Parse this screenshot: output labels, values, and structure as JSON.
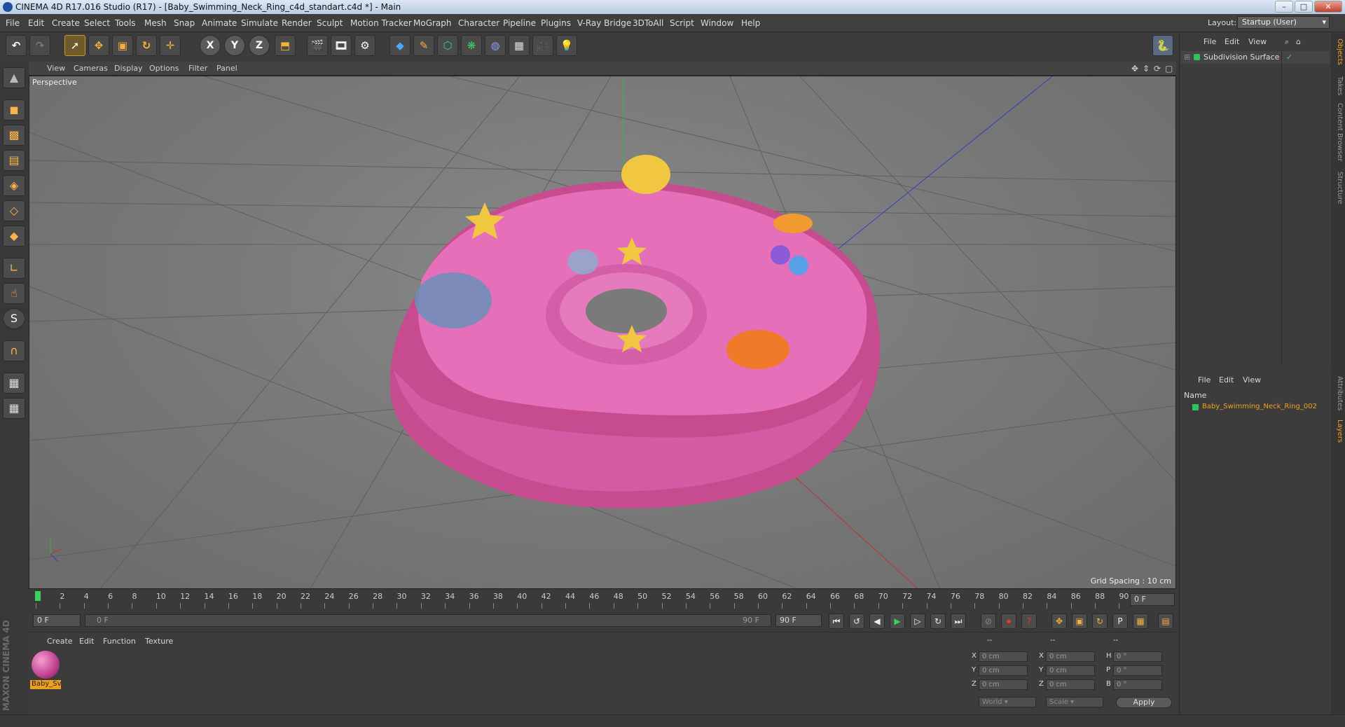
{
  "window": {
    "title": "CINEMA 4D R17.016 Studio (R17) - [Baby_Swimming_Neck_Ring_c4d_standart.c4d *] - Main"
  },
  "menu": [
    "File",
    "Edit",
    "Create",
    "Select",
    "Tools",
    "Mesh",
    "Snap",
    "Animate",
    "Simulate",
    "Render",
    "Sculpt",
    "Motion Tracker",
    "MoGraph",
    "Character",
    "Pipeline",
    "Plugins",
    "V-Ray Bridge",
    "3DToAll",
    "Script",
    "Window",
    "Help"
  ],
  "layout": {
    "label": "Layout:",
    "value": "Startup (User)"
  },
  "toolbar": {
    "axis_x": "X",
    "axis_y": "Y",
    "axis_z": "Z"
  },
  "viewport": {
    "menu": [
      "View",
      "Cameras",
      "Display",
      "Options",
      "Filter",
      "Panel"
    ],
    "label": "Perspective",
    "grid_spacing": "Grid Spacing : 10 cm"
  },
  "timeline": {
    "ticks": [
      "0",
      "2",
      "4",
      "6",
      "8",
      "10",
      "12",
      "14",
      "16",
      "18",
      "20",
      "22",
      "24",
      "26",
      "28",
      "30",
      "32",
      "34",
      "36",
      "38",
      "40",
      "42",
      "44",
      "46",
      "48",
      "50",
      "52",
      "54",
      "56",
      "58",
      "60",
      "62",
      "64",
      "66",
      "68",
      "70",
      "72",
      "74",
      "76",
      "78",
      "80",
      "82",
      "84",
      "86",
      "88",
      "90"
    ],
    "current_frame": "0 F"
  },
  "anim": {
    "start": "0 F",
    "range_start": "0 F",
    "range_end": "90 F",
    "end": "90 F"
  },
  "materials": {
    "menu": [
      "Create",
      "Edit",
      "Function",
      "Texture"
    ],
    "items": [
      {
        "name": "Baby_Sv"
      }
    ]
  },
  "coords": {
    "headers": [
      "--",
      "--",
      "--"
    ],
    "rows": [
      {
        "a": "X",
        "av": "0 cm",
        "b": "X",
        "bv": "0 cm",
        "c": "H",
        "cv": "0 °"
      },
      {
        "a": "Y",
        "av": "0 cm",
        "b": "Y",
        "bv": "0 cm",
        "c": "P",
        "cv": "0 °"
      },
      {
        "a": "Z",
        "av": "0 cm",
        "b": "Z",
        "bv": "0 cm",
        "c": "B",
        "cv": "0 °"
      }
    ],
    "world": "World",
    "scale": "Scale",
    "apply": "Apply"
  },
  "objects": {
    "menu": [
      "File",
      "Edit",
      "View"
    ],
    "items": [
      {
        "name": "Subdivision Surface"
      }
    ]
  },
  "layers": {
    "menu": [
      "File",
      "Edit",
      "View"
    ],
    "column": "Name",
    "items": [
      {
        "name": "Baby_Swimming_Neck_Ring_002"
      }
    ]
  },
  "right_tabs": [
    "Objects",
    "Takes",
    "Content Browser",
    "Structure",
    "Attributes",
    "Layers"
  ],
  "branding": "MAXON CINEMA 4D",
  "colors": {
    "accent": "#f0a020",
    "object_green": "#30c060",
    "ring_pink": "#e070b8"
  }
}
